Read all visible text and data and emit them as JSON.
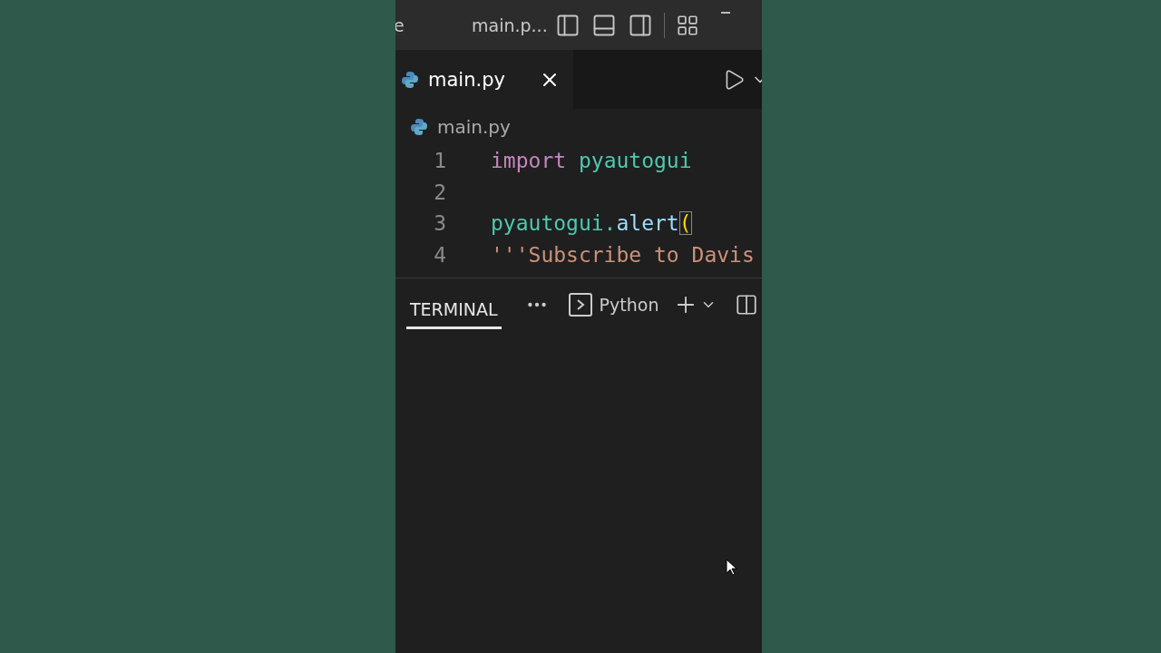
{
  "title_bar": {
    "menu_fragment": "e",
    "title": "main.p..."
  },
  "tabs": [
    {
      "label": "main.py",
      "selected": true
    }
  ],
  "breadcrumb": "main.py",
  "code": [
    {
      "number": "1",
      "tokens": [
        {
          "kind": "keyword",
          "text": "import"
        },
        {
          "kind": "module",
          "text": "pyautogui"
        }
      ]
    },
    {
      "number": "2"
    },
    {
      "number": "3",
      "tokens": [
        {
          "kind": "module",
          "text": "pyautogui."
        },
        {
          "kind": "function",
          "text": "alert"
        },
        {
          "kind": "bracket",
          "text": "("
        }
      ]
    },
    {
      "number": "4",
      "tokens": [
        {
          "kind": "string",
          "text": "'''Subscribe to Davis"
        }
      ]
    }
  ],
  "panel": {
    "tabs": [
      {
        "label": "TERMINAL",
        "selected": true
      }
    ],
    "shell": "Python"
  }
}
